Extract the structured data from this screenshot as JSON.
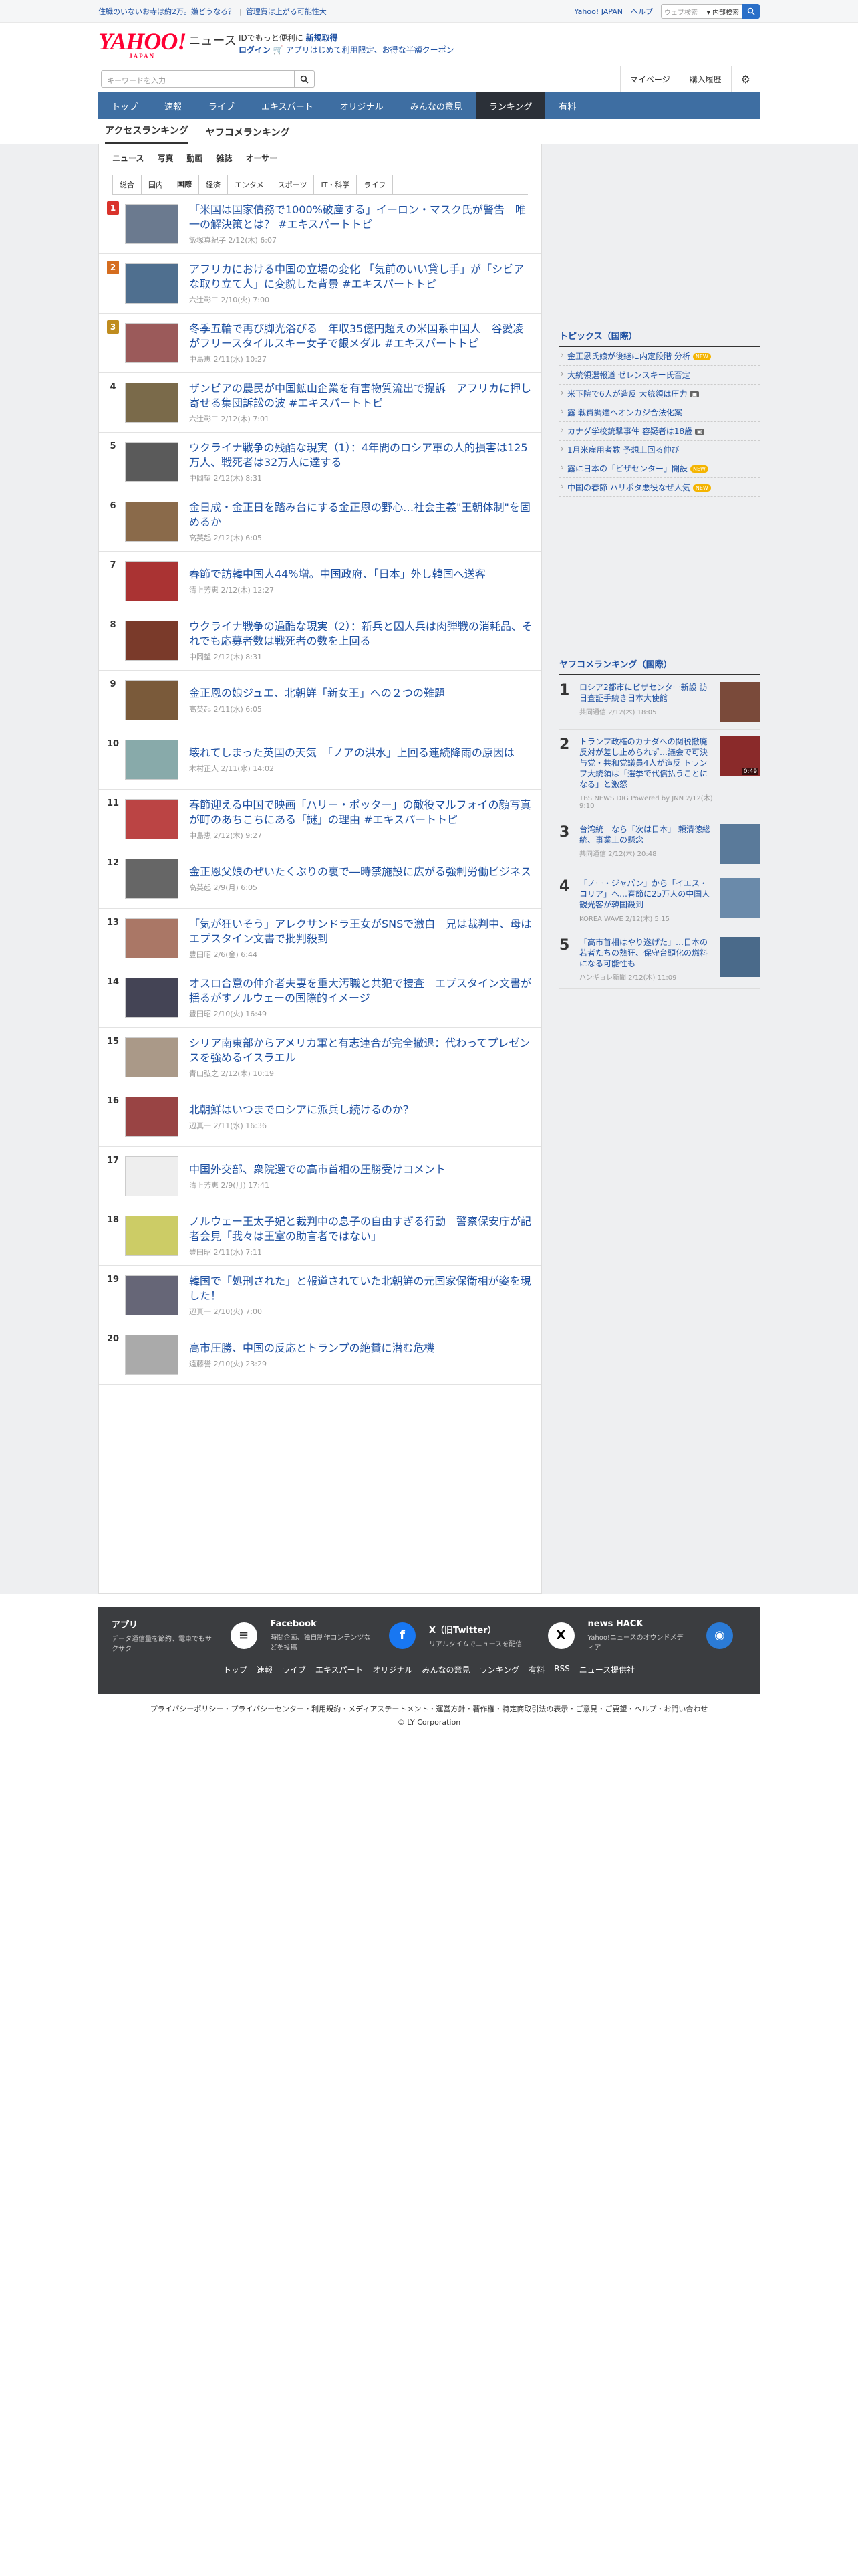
{
  "topbar": {
    "promo1": "住職のいないお寺は約2万。嫌どうなる？",
    "promo2": "管理費は上がる可能性大",
    "links": [
      "Yahoo! JAPAN",
      "ヘルプ"
    ],
    "search_placeholder": "ウェブ検索",
    "search_scope": "内部検索"
  },
  "brand": {
    "logo": "YAHOO!",
    "logo_sub": "JAPAN",
    "service": "ニュース",
    "msg1_pre": "IDでもっと便利に",
    "msg1_link": "新規取得",
    "msg2_login": "ログイン",
    "msg2_rest": "アプリはじめて利用限定、お得な半額クーポン"
  },
  "searchbar": {
    "placeholder": "キーワードを入力",
    "right": [
      "マイページ",
      "購入履歴"
    ]
  },
  "nav": [
    "トップ",
    "速報",
    "ライブ",
    "エキスパート",
    "オリジナル",
    "みんなの意見",
    "ランキング",
    "有料"
  ],
  "subtabs": [
    "アクセスランキング",
    "ヤフコメランキング"
  ],
  "genres": [
    "ニュース",
    "写真",
    "動画",
    "雑誌",
    "オーサー"
  ],
  "categories": [
    "総合",
    "国内",
    "国際",
    "経済",
    "エンタメ",
    "スポーツ",
    "IT・科学",
    "ライフ"
  ],
  "articles": [
    {
      "rank": "1",
      "title": "「米国は国家債務で1000%破産する」イーロン・マスク氏が警告　唯一の解決策とは？ #エキスパートトピ",
      "meta": "飯塚真紀子 2/12(木) 6:07"
    },
    {
      "rank": "2",
      "title": "アフリカにおける中国の立場の変化 「気前のいい貸し手」が「シビアな取り立て人」に変貌した背景 #エキスパートトピ",
      "meta": "六辻彰二 2/10(火) 7:00"
    },
    {
      "rank": "3",
      "title": "冬季五輪で再び脚光浴びる　年収35億円超えの米国系中国人　谷愛凌がフリースタイルスキー女子で銀メダル #エキスパートトピ",
      "meta": "中島恵 2/11(水) 10:27"
    },
    {
      "rank": "4",
      "title": "ザンビアの農民が中国鉱山企業を有害物質流出で提訴　アフリカに押し寄せる集団訴訟の波 #エキスパートトピ",
      "meta": "六辻彰二 2/12(木) 7:01"
    },
    {
      "rank": "5",
      "title": "ウクライナ戦争の残酷な現実（1）：4年間のロシア軍の人的損害は125万人、戦死者は32万人に達する",
      "meta": "中岡望 2/12(木) 8:31"
    },
    {
      "rank": "6",
      "title": "金日成・金正日を踏み台にする金正恩の野心…社会主義\"王朝体制\"を固めるか",
      "meta": "高英起 2/12(木) 6:05"
    },
    {
      "rank": "7",
      "title": "春節で訪韓中国人44%増。中国政府、「日本」外し韓国へ送客",
      "meta": "清上芳恵 2/12(木) 12:27"
    },
    {
      "rank": "8",
      "title": "ウクライナ戦争の過酷な現実（2）：新兵と囚人兵は肉弾戦の消耗品、それでも応募者数は戦死者の数を上回る",
      "meta": "中岡望 2/12(木) 8:31"
    },
    {
      "rank": "9",
      "title": "金正恩の娘ジュエ、北朝鮮「新女王」への２つの難題",
      "meta": "高英起 2/11(水) 6:05"
    },
    {
      "rank": "10",
      "title": "壊れてしまった英国の天気　「ノアの洪水」上回る連続降雨の原因は",
      "meta": "木村正人 2/11(水) 14:02"
    },
    {
      "rank": "11",
      "title": "春節迎える中国で映画「ハリー・ポッター」の敵役マルフォイの顔写真が町のあちこちにある「謎」の理由 #エキスパートトピ",
      "meta": "中島恵 2/12(木) 9:27"
    },
    {
      "rank": "12",
      "title": "金正恩父娘のぜいたくぶりの裏で―時禁施設に広がる強制労働ビジネス",
      "meta": "高英起 2/9(月) 6:05"
    },
    {
      "rank": "13",
      "title": "「気が狂いそう」アレクサンドラ王女がSNSで激白　兄は裁判中、母はエプスタイン文書で批判殺到",
      "meta": "豊田昭 2/6(金) 6:44"
    },
    {
      "rank": "14",
      "title": "オスロ合意の仲介者夫妻を重大汚職と共犯で捜査　エプスタイン文書が揺るがすノルウェーの国際的イメージ",
      "meta": "豊田昭 2/10(火) 16:49"
    },
    {
      "rank": "15",
      "title": "シリア南東部からアメリカ軍と有志連合が完全撤退：代わってプレゼンスを強めるイスラエル",
      "meta": "青山弘之 2/12(木) 10:19"
    },
    {
      "rank": "16",
      "title": "北朝鮮はいつまでロシアに派兵し続けるのか？",
      "meta": "辺真一 2/11(水) 16:36"
    },
    {
      "rank": "17",
      "title": "中国外交部、衆院選での高市首相の圧勝受けコメント",
      "meta": "清上芳恵 2/9(月) 17:41"
    },
    {
      "rank": "18",
      "title": "ノルウェー王太子妃と裁判中の息子の自由すぎる行動　警察保安庁が記者会見「我々は王室の助言者ではない」",
      "meta": "豊田昭 2/11(水) 7:11"
    },
    {
      "rank": "19",
      "title": "韓国で「処刑された」と報道されていた北朝鮮の元国家保衛相が姿を現した！",
      "meta": "辺真一 2/10(火) 7:00"
    },
    {
      "rank": "20",
      "title": "高市圧勝、中国の反応とトランプの絶賛に潜む危機",
      "meta": "遠藤誉 2/10(火) 23:29"
    }
  ],
  "topics": {
    "title": "トピックス（国際）",
    "items": [
      {
        "text": "金正恩氏娘が後継に内定段階 分析",
        "tag": "NEW"
      },
      {
        "text": "大統領選報道 ゼレンスキー氏否定",
        "tag": ""
      },
      {
        "text": "米下院で6人が造反 大統領は圧力",
        "tag": "img"
      },
      {
        "text": "露 戦費調達へオンカジ合法化案",
        "tag": ""
      },
      {
        "text": "カナダ学校銃撃事件 容疑者は18歳",
        "tag": "img"
      },
      {
        "text": "1月米雇用者数 予想上回る伸び",
        "tag": ""
      },
      {
        "text": "露に日本の「ビザセンター」開設",
        "tag": "NEW"
      },
      {
        "text": "中国の春節 ハリポタ悪役なぜ人気",
        "tag": "NEW"
      }
    ]
  },
  "ycomment": {
    "title": "ヤフコメランキング（国際）",
    "items": [
      {
        "rank": "1",
        "title": "ロシア2都市にビザセンター新設 訪日査証手続き日本大使館",
        "meta": "共同通信 2/12(木) 18:05",
        "dur": ""
      },
      {
        "rank": "2",
        "title": "トランプ政権のカナダへの関税撤廃 反対が差し止められず…議会で可決　与党・共和党議員4人が造反 トランプ大統領は「選挙で代償払うことになる」と激怒",
        "meta": "TBS NEWS DIG Powered by JNN 2/12(木) 9:10",
        "dur": "0:49"
      },
      {
        "rank": "3",
        "title": "台湾統一なら「次は日本」 頼清徳総統、事業上の懸念",
        "meta": "共同通信 2/12(木) 20:48",
        "dur": ""
      },
      {
        "rank": "4",
        "title": "「ノー・ジャパン」から「イエス・コリア」へ…春節に25万人の中国人観光客が韓国殺到",
        "meta": "KOREA WAVE 2/12(木) 5:15",
        "dur": ""
      },
      {
        "rank": "5",
        "title": "「高市首相はやり遂げた」…日本の若者たちの熱狂、保守台頭化の燃料になる可能性も",
        "meta": "ハンギョレ新聞 2/12(木) 11:09",
        "dur": ""
      }
    ]
  },
  "footer": {
    "apps": [
      {
        "title": "アプリ",
        "desc": "データ通信量を節約、電車でもサクサク",
        "icon": "yahoo-news-app-icon"
      },
      {
        "title": "Facebook",
        "desc": "時間企画、独自制作コンテンツなどを投稿",
        "icon": "facebook-icon"
      },
      {
        "title": "X（旧Twitter）",
        "desc": "リアルタイムでニュースを配信",
        "icon": "x-icon"
      },
      {
        "title": "news HACK",
        "desc": "Yahoo!ニュースのオウンドメディア",
        "icon": "newshack-icon"
      }
    ],
    "links": [
      "トップ",
      "速報",
      "ライブ",
      "エキスパート",
      "オリジナル",
      "みんなの意見",
      "ランキング",
      "有料",
      "RSS",
      "ニュース提供社"
    ],
    "legal": "プライバシーポリシー・プライバシーセンター・利用規約・メディアステートメント・運営方針・著作権・特定商取引法の表示・ご意見・ご要望・ヘルプ・お問い合わせ",
    "copyright": "© LY Corporation"
  },
  "colors": {
    "link": "#1e50a2",
    "nav": "#3e6ea2",
    "nav_active": "#2b3038",
    "rank1": "#d9332b",
    "rank2": "#d56d1f",
    "rank3": "#bf8c1f"
  }
}
